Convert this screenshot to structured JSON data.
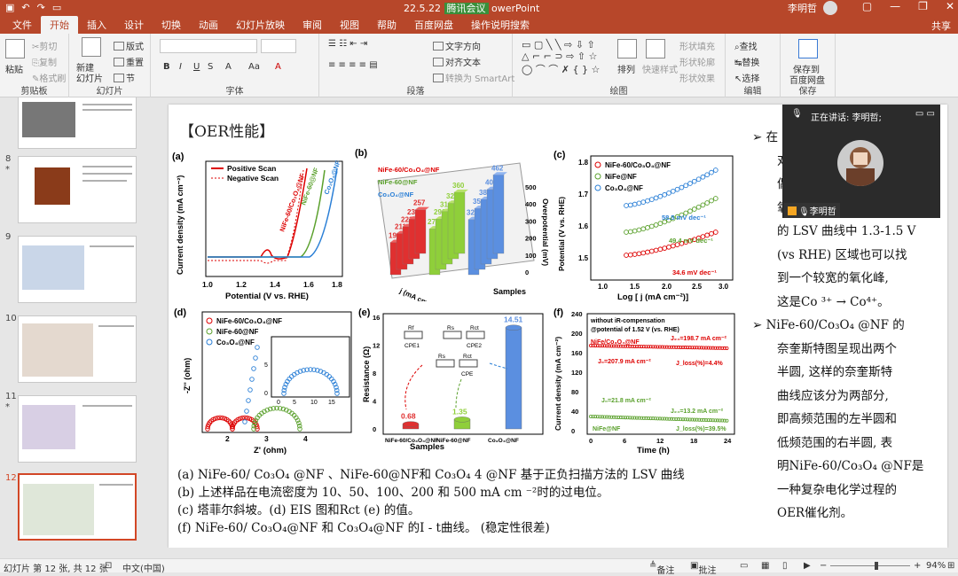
{
  "titlebar": {
    "title_left": "22.5.22",
    "title_badge": "腾讯会议",
    "title_right": "owerPoint",
    "user": "李明哲"
  },
  "tabs": [
    "文件",
    "开始",
    "插入",
    "设计",
    "切换",
    "动画",
    "幻灯片放映",
    "审阅",
    "视图",
    "帮助",
    "百度网盘",
    "操作说明搜索"
  ],
  "share": "共享",
  "ribbon": {
    "clipboard": {
      "paste": "粘贴",
      "cut": "剪切",
      "copy": "复制",
      "painter": "格式刷",
      "name": "剪贴板"
    },
    "slides": {
      "new": "新建",
      "new2": "幻灯片",
      "layout": "版式",
      "reset": "重置",
      "section": "节",
      "name": "幻灯片"
    },
    "font": {
      "name": "字体"
    },
    "paragraph": {
      "textdir": "文字方向",
      "align": "对齐文本",
      "smartart": "转换为 SmartArt",
      "name": "段落"
    },
    "drawing": {
      "arrange": "排列",
      "styles": "快速样式",
      "fill": "形状填充",
      "outline": "形状轮廓",
      "effects": "形状效果",
      "name": "绘图"
    },
    "editing": {
      "find": "查找",
      "replace": "替换",
      "select": "选择",
      "name": "编辑"
    },
    "save": {
      "label1": "保存到",
      "label2": "百度网盘",
      "name": "保存"
    }
  },
  "thumbs": [
    {
      "num": "8",
      "star": "*"
    },
    {
      "num": "9"
    },
    {
      "num": "10"
    },
    {
      "num": "11",
      "star": "*"
    },
    {
      "num": "12"
    }
  ],
  "slide": {
    "title": "【OER性能】",
    "panel_labels": [
      "(a)",
      "(b)",
      "(c)",
      "(d)",
      "(e)",
      "(f)"
    ],
    "captions": [
      "(a) NiFe-60/ Co₃O₄ @NF 、NiFe-60@NF和 Co₃O₄ 4 @NF 基于正负扫描方法的 LSV 曲线",
      "(b) 上述样品在电流密度为 10、50、100、200 和 500 mA cm ⁻²时的过电位。",
      "(c) 塔菲尔斜坡。(d) EIS 图和Rct (e) 的值。",
      "(f) NiFe-60/ Co₃O₄@NF 和 Co₃O₄@NF 的I - t曲线。 (稳定性很差)"
    ],
    "right_lines": [
      "➢ 在",
      "对",
      "偶",
      "氧",
      "的 LSV 曲线中 1.3-1.5 V",
      "(vs RHE) 区域也可以找",
      "到一个较宽的氧化峰,",
      "这是Co ³⁺ → Co⁴⁺。",
      "➢ NiFe-60/Co₃O₄ @NF 的",
      "奈奎斯特图呈现出两个",
      "半圆, 这样的奈奎斯特",
      "曲线应该分为两部分,",
      "即高频范围的左半圆和",
      "低频范围的右半圆, 表",
      "明NiFe-60/Co₃O₄ @NF是",
      "一种复杂电化学过程的",
      "OER催化剂。"
    ]
  },
  "chart_data": [
    {
      "type": "line",
      "panel": "(a)",
      "xlabel": "Potential (V vs. RHE)",
      "ylabel": "Current density (mA cm⁻²)",
      "xticks": [
        "1.0",
        "1.2",
        "1.4",
        "1.6",
        "1.8"
      ],
      "legend": [
        "Positive Scan",
        "Negative Scan"
      ],
      "series_labels": [
        "NiFe-60/Co₃O₄@NF",
        "NiFe-60@NF",
        "Co₃O₄@NF"
      ]
    },
    {
      "type": "bar",
      "panel": "(b)",
      "title_legend": [
        "NiFe-60/Co₃O₄@NF",
        "NiFe-60@NF",
        "Co₃O₄@NF"
      ],
      "ylabel": "Overpotential (mV)",
      "xlabel": "Samples",
      "zlabel": "j (mA cm⁻²)",
      "yticks": [
        "0",
        "100",
        "200",
        "300",
        "400",
        "500"
      ],
      "series": [
        {
          "name": "NiFe-60/Co₃O₄@NF",
          "values": [
            190,
            211,
            221,
            234,
            257
          ]
        },
        {
          "name": "NiFe-60@NF",
          "values": [
            270,
            296,
            310,
            327,
            360
          ]
        },
        {
          "name": "Co₃O₄@NF",
          "values": [
            325,
            359,
            381,
            408,
            462
          ]
        }
      ],
      "depth_ticks": [
        "500",
        "200",
        "100",
        "50",
        "10"
      ]
    },
    {
      "type": "scatter",
      "panel": "(c)",
      "xlabel": "Log [ j (mA cm⁻²)]",
      "ylabel": "Potential (V vs. RHE)",
      "xticks": [
        "1.0",
        "1.5",
        "2.0",
        "2.5",
        "3.0"
      ],
      "yticks": [
        "1.5",
        "1.6",
        "1.7",
        "1.8"
      ],
      "legend": [
        "NiFe-60/Co₃O₄@NF",
        "NiFe@NF",
        "Co₃O₄@NF"
      ],
      "annotations": [
        "58.5 mV dec⁻¹",
        "49.4 mV dec⁻¹",
        "34.6 mV dec⁻¹"
      ]
    },
    {
      "type": "scatter",
      "panel": "(d)",
      "xlabel": "Z' (ohm)",
      "ylabel": "-Z'' (ohm)",
      "xticks": [
        "2",
        "3",
        "4"
      ],
      "legend": [
        "NiFe-60/Co₃O₄@NF",
        "NiFe-60@NF",
        "Co₃O₄@NF"
      ],
      "inset_xticks": [
        "0",
        "5",
        "10",
        "15"
      ],
      "inset_yticks": [
        "0",
        "5"
      ]
    },
    {
      "type": "bar",
      "panel": "(e)",
      "categories": [
        "NiFe-60/Co₃O₄@NF",
        "NiFe-60@NF",
        "Co₃O₄@NF"
      ],
      "values": [
        0.68,
        1.35,
        14.51
      ],
      "xlabel": "Samples",
      "ylabel": "Resistance (Ω)",
      "ylim": [
        0,
        16
      ],
      "yticks": [
        "0",
        "4",
        "8",
        "12",
        "16"
      ],
      "circuit_labels": [
        "Rf",
        "Rs",
        "Rct",
        "CPE1",
        "CPE2",
        "Rs",
        "Rct",
        "CPE"
      ]
    },
    {
      "type": "line",
      "panel": "(f)",
      "xlabel": "Time (h)",
      "ylabel": "Current density (mA cm⁻²)",
      "xticks": [
        "0",
        "6",
        "12",
        "18",
        "24"
      ],
      "yticks": [
        "0",
        "40",
        "80",
        "120",
        "160",
        "200",
        "240"
      ],
      "notes": [
        "without iR-compensation",
        "@potential of 1.52 V (vs. RHE)"
      ],
      "annotations": [
        "NiFe/Co₃O₄@NF",
        "J₂₄=198.7 mA cm⁻²",
        "J₀=207.9 mA cm⁻²",
        "J_loss(%)=4.4%",
        "J₀=21.8 mA cm⁻²",
        "J₂₄=13.2 mA cm⁻²",
        "NiFe@NF",
        "J_loss(%)=39.5%"
      ]
    }
  ],
  "overlay": {
    "speaking": "正在讲话: 李明哲;",
    "name": "李明哲"
  },
  "status": {
    "slide": "幻灯片 第 12 张, 共 12 张",
    "lang": "中文(中国)",
    "notes": "备注",
    "comments": "批注",
    "zoom": "94%"
  }
}
